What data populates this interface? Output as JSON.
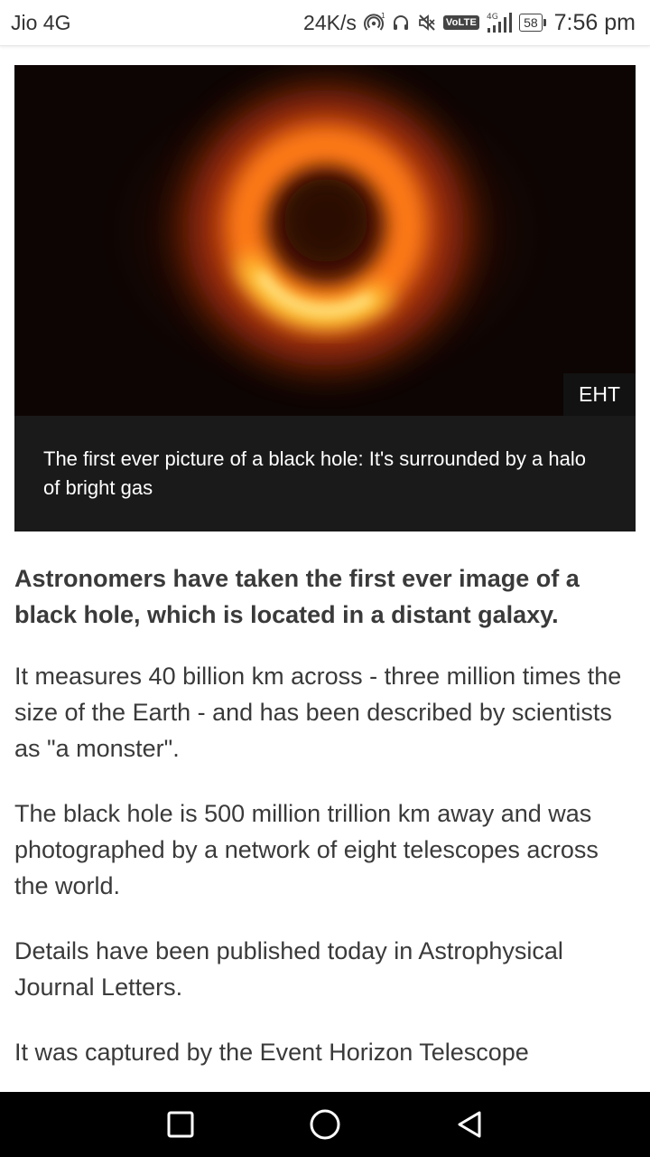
{
  "status_bar": {
    "carrier": "Jio 4G",
    "net_speed": "24K/s",
    "network_badge": "VoLTE",
    "network_type": "4G",
    "battery": "58",
    "time": "7:56 pm",
    "icons": [
      "hotspot-icon",
      "headphones-icon",
      "mute-icon",
      "volte-icon",
      "signal-icon",
      "battery-icon"
    ]
  },
  "figure": {
    "credit": "EHT",
    "caption": "The first ever picture of a black hole: It's surrounded by a halo of bright gas",
    "colors": {
      "ring_bright": "#ffd23a",
      "ring_mid": "#ff8a1c",
      "ring_outer": "#c43a06",
      "center": "#2a0c04",
      "background": "#0d0503"
    }
  },
  "article": {
    "lead": "Astronomers have taken the first ever image of a black hole, which is located in a distant galaxy.",
    "paragraphs": [
      "It measures 40 billion km across - three million times the size of the Earth - and has been described by scientists as \"a monster\".",
      "The black hole is 500 million trillion km away and was photographed by a network of eight telescopes across the world.",
      "Details have been published today in Astrophysical Journal Letters.",
      "It was captured by the Event Horizon Telescope"
    ]
  },
  "nav_bar": {
    "buttons": [
      "recent-apps",
      "home",
      "back"
    ]
  }
}
